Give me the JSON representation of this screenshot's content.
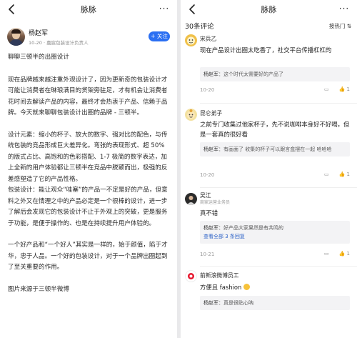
{
  "left": {
    "nav_title": "脉脉",
    "more_icon": "···",
    "author": {
      "name": "杨赵军",
      "sub": "10-20 · 嘉宸包装设计负责人",
      "follow": "+ 关注"
    },
    "article": {
      "heading": "聊聊三顿半的出圈设计",
      "para1": "现在品牌越来越注重外观设计了，因为更新奇的包装设计才可能让消费者在琳琅满目的货架旁驻足，才有机会让消费者花时间去解读产品的内容，最终才会热衷于产品、信赖于品牌。今天就来聊聊包装设计出圈的品牌 - 三顿半。",
      "para2": "设计元素：缩小的杯子、放大的数字、强对比的配色，与传统包装的竞品形成巨大差异化。弯张的表现形式、超 50% 的版式占比、高饱和的色彩搭配、1-7 极简的数字表达，加上全新的用户体验都让三顿半在竞品中脱颖而出，极强的反差感塑造了它的产品性格。",
      "para3": "包装设计：能让观众“哇塞”的产品一不定是好的产品，但意料之外又在情理之中的产品必定是一个很棒的设计，进一步了解后会发现它的包装设计不止于外观上的突破，更是服务于功能，是便于操作的、也是在持续提升用户体验的。",
      "para4": "一个好产品和“一个好人”其实是一样的，始于颜值，陷于才华，忠于人品。一个好的包装设计，对于一个品牌出圈起到了至关重要的作用。",
      "source": "图片来源于三顿半微博"
    }
  },
  "right": {
    "nav_title": "脉脉",
    "more_icon": "···",
    "comment_count": "30条评论",
    "sort_label": "按热门 ⇅",
    "comments": [
      {
        "name": "宋兵乙",
        "text": "现在产品设计出圈太吃香了，社交平台传播杠杠的",
        "reply_name": "杨赵军",
        "reply_author_tag": "作者",
        "reply_text": "：这个时代太需要好的产品了",
        "date": "10-20",
        "likes": "1"
      },
      {
        "name": "昆仑弟子",
        "text": "之前专门收集过他家杯子，先不说咖啡本身好不好喝，但是一套真的很好看",
        "reply_name": "杨赵军",
        "reply_author_tag": "作者",
        "reply_text": "：有画面了 收集的杯子可以跟言盒摆在一起 哈哈哈",
        "date": "10-20",
        "likes": "1"
      },
      {
        "name": "吴江",
        "sub": "商家运营业务员",
        "text": "真不错",
        "reply_name": "杨赵军",
        "reply_author_tag": "作者",
        "reply_text": "：好产品大家果然是有共鸣的",
        "reply_more": "查看全部 3 条回复",
        "date": "10-21",
        "likes": "1"
      },
      {
        "name": "前新浪微博员工",
        "text": "方便且 fashion",
        "reply_name": "杨赵军",
        "reply_author_tag": "作者",
        "reply_text": "：真是很贴心呐"
      }
    ]
  },
  "colors": {
    "accent": "#2b6ff2",
    "link": "#2d62c7",
    "author_tag": "#2d62c7"
  }
}
